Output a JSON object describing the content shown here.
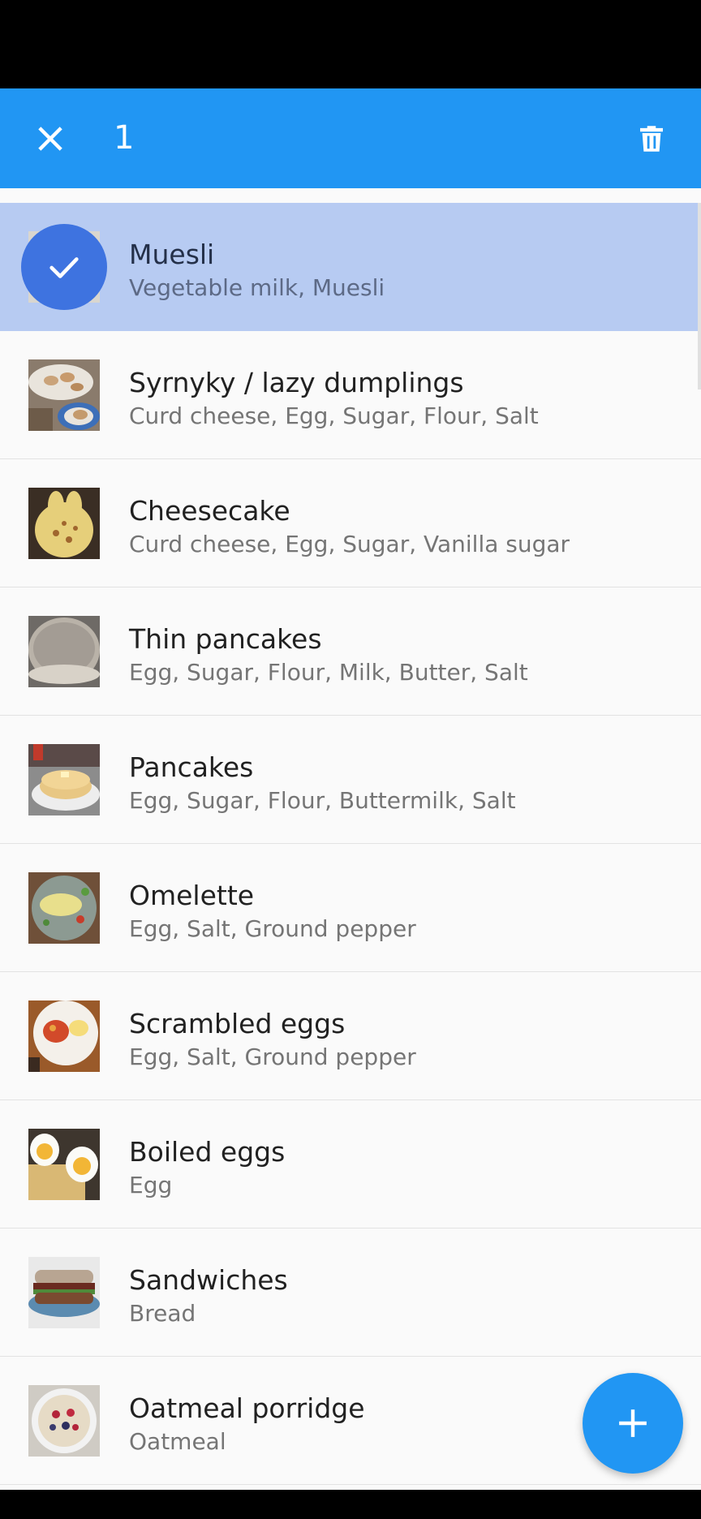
{
  "app_bar": {
    "selected_count": "1",
    "close_icon": "close-icon",
    "delete_icon": "trash-icon",
    "background": "#2196f3"
  },
  "recipes": [
    {
      "title": "Muesli",
      "ingredients": "Vegetable milk, Muesli",
      "selected": true
    },
    {
      "title": "Syrnyky / lazy dumplings",
      "ingredients": "Curd cheese, Egg, Sugar, Flour, Salt",
      "selected": false
    },
    {
      "title": "Cheesecake",
      "ingredients": "Curd cheese, Egg, Sugar, Vanilla sugar",
      "selected": false
    },
    {
      "title": "Thin pancakes",
      "ingredients": "Egg, Sugar, Flour, Milk, Butter, Salt",
      "selected": false
    },
    {
      "title": "Pancakes",
      "ingredients": "Egg, Sugar, Flour, Buttermilk, Salt",
      "selected": false
    },
    {
      "title": "Omelette",
      "ingredients": "Egg, Salt, Ground pepper",
      "selected": false
    },
    {
      "title": "Scrambled eggs",
      "ingredients": "Egg, Salt, Ground pepper",
      "selected": false
    },
    {
      "title": "Boiled eggs",
      "ingredients": "Egg",
      "selected": false
    },
    {
      "title": "Sandwiches",
      "ingredients": "Bread",
      "selected": false
    },
    {
      "title": "Oatmeal porridge",
      "ingredients": "Oatmeal",
      "selected": false
    }
  ],
  "fab": {
    "icon": "plus-icon"
  },
  "colors": {
    "accent": "#2196f3",
    "selected_row": "#b7cbf2",
    "check_circle": "#3e73e0"
  }
}
